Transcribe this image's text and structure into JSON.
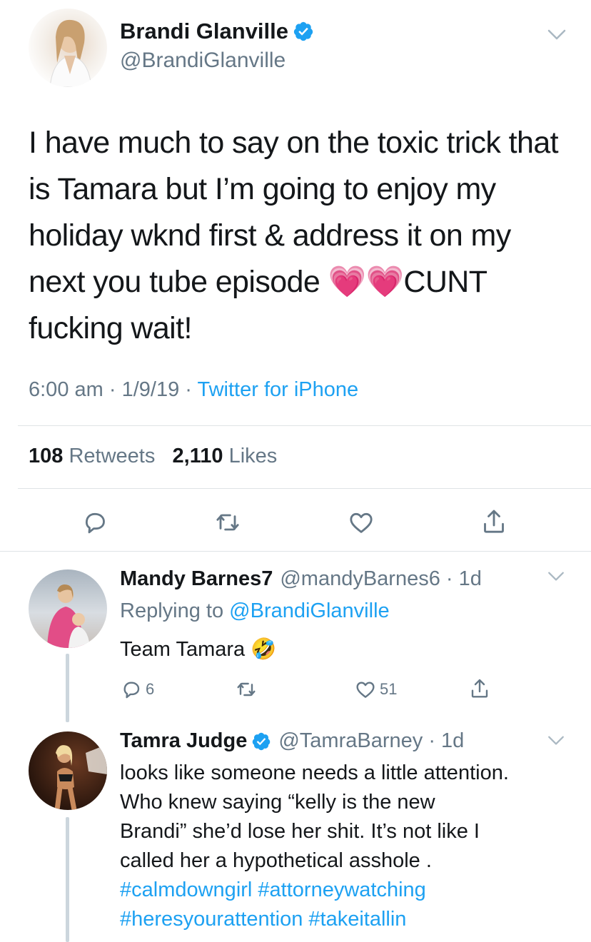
{
  "main_tweet": {
    "author_name": "Brandi Glanville",
    "author_handle": "@BrandiGlanville",
    "text_lines": [
      "I have much to say on the toxic trick that",
      "is Tamara but I’m going to enjoy my",
      "holiday wknd first & address it on my",
      "next you tube episode 💗💗CUNT",
      "fucking wait!"
    ],
    "time": "6:00 am",
    "date": "1/9/19",
    "source": "Twitter for iPhone",
    "retweets_count": "108",
    "retweets_label": "Retweets",
    "likes_count": "2,110",
    "likes_label": "Likes"
  },
  "replies": [
    {
      "author_name": "Mandy Barnes7",
      "author_handle": "@mandyBarnes6",
      "age": "1d",
      "replying_prefix": "Replying to",
      "replying_to": "@BrandiGlanville",
      "text": "Team Tamara 🤣",
      "reply_count": "6",
      "like_count": "51"
    },
    {
      "author_name": "Tamra Judge",
      "author_handle": "@TamraBarney",
      "age": "1d",
      "text_lines": [
        "looks like someone needs  a little attention.",
        "Who knew saying “kelly  is the new",
        "Brandi” she’d lose her shit.  It’s not like I",
        "called her a hypothetical asshole ."
      ],
      "hashtags_line1": [
        "#calmdowngirl",
        "#attorneywatching"
      ],
      "hashtags_line2": [
        "#heresyourattention",
        "#takeitallin"
      ]
    }
  ],
  "colors": {
    "link": "#1da1f2",
    "muted": "#657786",
    "text": "#14171a",
    "verified": "#1da1f2"
  },
  "icons": [
    "verified-badge-icon",
    "chevron-down-icon",
    "reply-icon",
    "retweet-icon",
    "like-icon",
    "share-icon"
  ]
}
